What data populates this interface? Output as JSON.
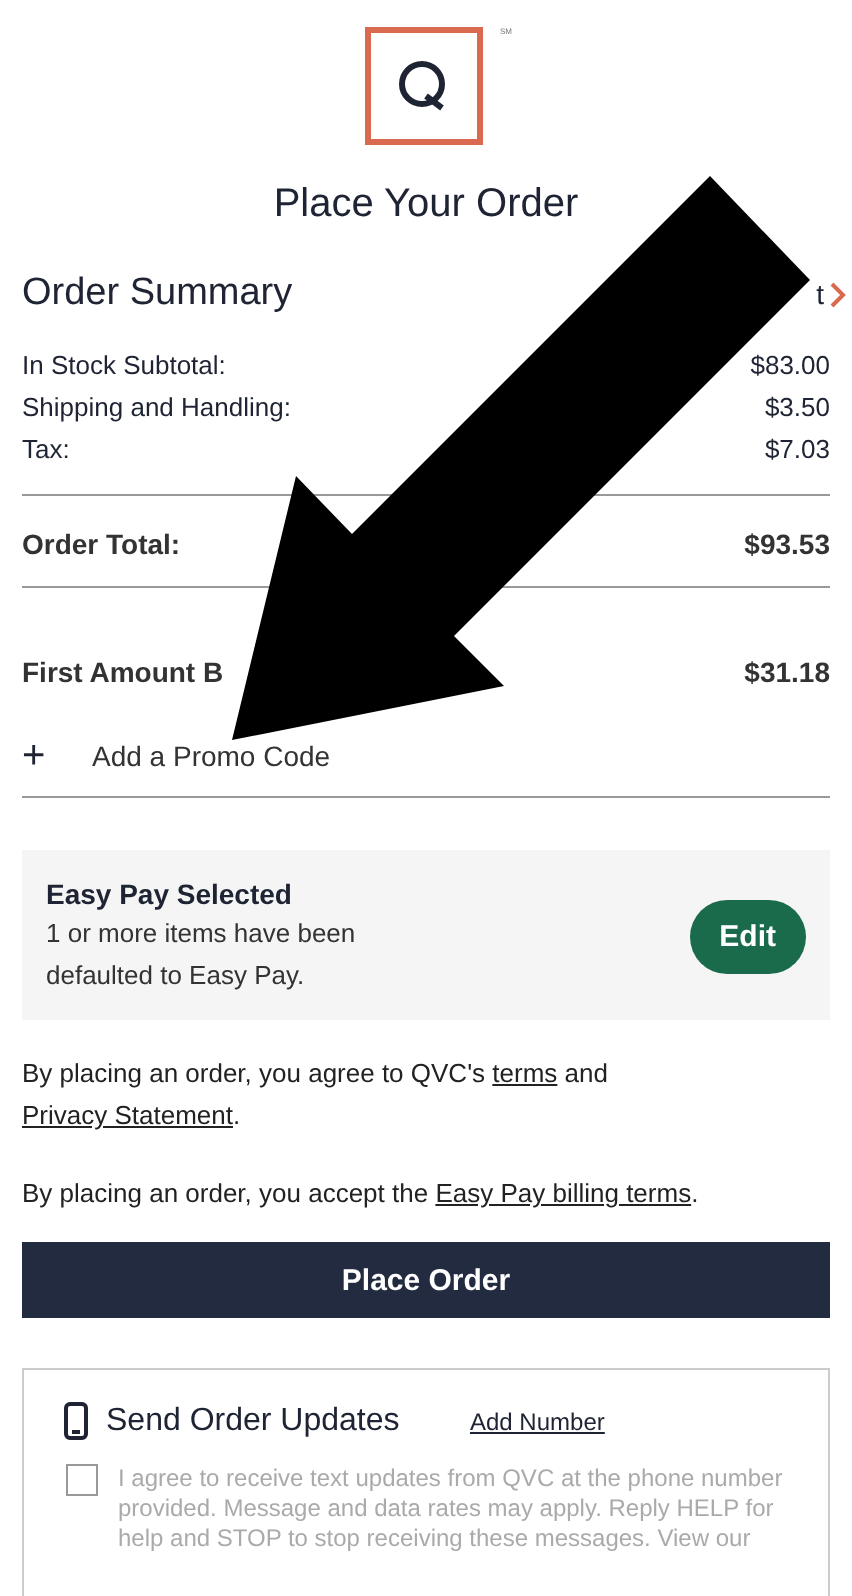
{
  "header": {
    "logo_mark": "SM",
    "title": "Place Your Order"
  },
  "summary": {
    "title": "Order Summary",
    "link": "t",
    "lines": [
      {
        "label": "In Stock Subtotal:",
        "value": "$83.00"
      },
      {
        "label": "Shipping and Handling:",
        "value": "$3.50"
      },
      {
        "label": "Tax:",
        "value": "$7.03"
      }
    ],
    "total": {
      "label": "Order Total:",
      "value": "$93.53"
    },
    "first_amount": {
      "label": "First Amount B",
      "value": "$31.18"
    },
    "promo": {
      "icon": "+",
      "label": "Add a Promo Code"
    }
  },
  "easy_pay": {
    "title": "Easy Pay Selected",
    "text": "1 or more items have been defaulted to Easy Pay.",
    "button": "Edit"
  },
  "terms": [
    {
      "parts": [
        {
          "kind": "text",
          "text": "By placing an order, you agree to QVC's "
        },
        {
          "kind": "link",
          "text": "terms"
        },
        {
          "kind": "text",
          "text": " and "
        },
        {
          "kind": "link",
          "text": "Privacy Statement"
        },
        {
          "kind": "text",
          "text": "."
        }
      ]
    },
    {
      "parts": [
        {
          "kind": "text",
          "text": "By placing an order, you accept the "
        },
        {
          "kind": "link",
          "text": "Easy Pay billing terms"
        },
        {
          "kind": "text",
          "text": "."
        }
      ]
    }
  ],
  "place_order": "Place Order",
  "updates": {
    "title": "Send Order Updates",
    "link": "Add Number",
    "checked": false,
    "consent": "I agree to receive text updates from QVC at the phone number provided. Message and data rates may apply. Reply HELP for help and STOP to stop receiving these messages. View our"
  }
}
